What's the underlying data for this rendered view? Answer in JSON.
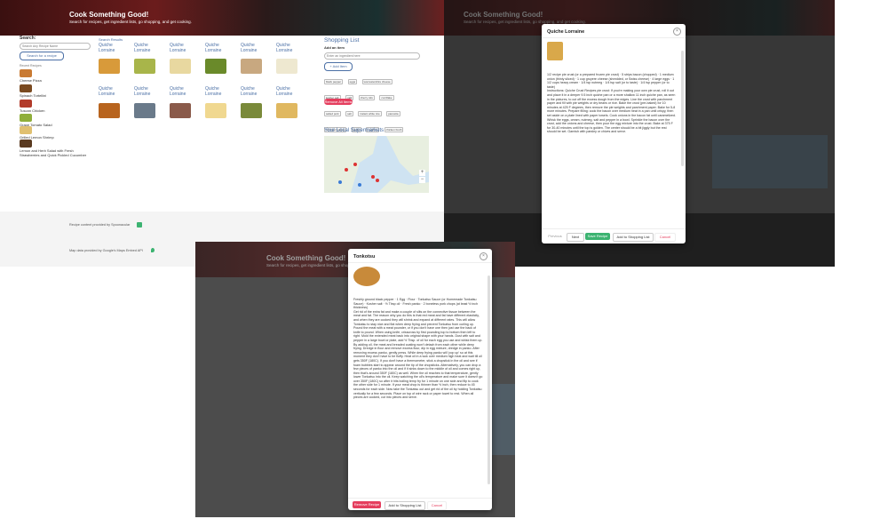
{
  "app": {
    "title": "Cook Something Good!",
    "subtitle": "Search for recipes, get ingredient lists, go shopping, and get cooking."
  },
  "search": {
    "label": "Search:",
    "placeholder": "Search Any Recipe Name",
    "button": "Search for a recipe",
    "results_label": "Search Results"
  },
  "history": {
    "label": "Recent Recipes",
    "items": [
      "Cheese Pizza",
      "Spinach Tortellini",
      "Tuscan Chicken",
      "Grape Tomato Salad",
      "Grilled Lemon Shrimp",
      "Garlic Potato Pancake",
      "Green Salad",
      "Lemon and Herb Salad with Fresh Strawberries and Quick Pickled Cucumber"
    ]
  },
  "results": {
    "row1": [
      "Quiche Lorraine",
      "Quiche Lorraine",
      "Quiche Lorraine",
      "Quiche Lorraine",
      "Quiche Lorraine",
      "Quiche Lorraine"
    ],
    "row2": [
      "Quiche Lorraine",
      "Quiche Lorraine",
      "Quiche Lorraine",
      "Quiche Lorraine",
      "Quiche Lorraine",
      "Quiche Lorraine"
    ]
  },
  "shopping": {
    "title": "Shopping List",
    "add_label": "Add an item",
    "input_placeholder": "Enter an ingredient here",
    "add_button": "+ Add Item",
    "chips": [
      "black pepper",
      "eggs",
      "worcestershire cheese",
      "kosher salt",
      "milk",
      "cherry tofu",
      "cornflake",
      "salted pork",
      "salt",
      "instant white rice",
      "pancetta",
      "rich beef patties",
      "garlic",
      "zucchini",
      "chicken broth",
      "flour",
      "cilantro",
      "fish sauce",
      "sharp cheddar",
      "onion"
    ],
    "remove_button": "Remove All Items"
  },
  "supermarkets": {
    "title": "Your Local Supermarkets"
  },
  "footer": {
    "recipe_credit": "Recipe content provided by Spoonacular",
    "map_credit": "Map data provided by Google's Maps Embed API"
  },
  "modal1": {
    "title": "Quiche Lorraine",
    "ingredients": "1/2 recipe pie crust (or a prepared frozen pie crust) · 5 strips bacon (chopped) · 1 medium onion (thinly sliced) · 1 cup gruyere cheese (shredded, or Swiss cheese) · 4 large eggs · 1 1/2 cups heavy cream · 1/4 tsp nutmeg · 1/4 tsp salt (or to taste) · 1/4 tsp pepper (or to taste)",
    "instructions": "Instructions: Quiche Crust Recipes pie crust: If you're making your own pie crust, roll it out and place it in a deeper 9.5 inch quiche pan or a more shallow 11 inch quiche pan, as seen in the pictures, to cut off the excess dough from the edges. Line the crust with parchment paper and fill with pie weights or dry beans or rice. Bake the crust (pre-baked) for 10 minutes at 425 F degrees, then remove the pie weights and parchment paper. Bake for 5-8 more minutes. Prepare filling: cook the bacon over medium heat in a pan until crispy, then set aside on a plate lined with paper towels. Cook onions in the bacon fat until caramelized. Whisk the eggs, cream, nutmeg, salt and pepper in a bowl. Sprinkle the bacon over the crust, add the onions and cheese, then pour the egg mixture into the crust. Bake at 375 F for 30-40 minutes until the top is golden. The center should be a bit jiggly but the rest should be set. Garnish with parsley or chives and serve.",
    "buttons": [
      "Previous",
      "Next",
      "Save Recipe",
      "Add to Shopping List",
      "Cancel"
    ]
  },
  "modal2": {
    "title": "Tonkotsu",
    "ingredients": "Freshly ground black pepper · 1 Egg · Flour · Tonkatsu Sauce (or Homemade Tonkatsu Sauce) · Kosher salt · ½ Tbsp oil · Fresh panko · 2 boneless pork chops (at least ½ inch thickness)",
    "instructions": "Get rid of the extra fat and make a couple of slits on the connective tissue between the meat and fat. The reason why you do this is that red meat and fat have different elasticity, and when they are cooked they will shrink and expand at different rates. This will allow Tonkatsu to stay nice and flat when deep frying and prevent Tonkatsu from curling up. Pound the meat with a meat pounder, or if you don't have one then just use the back of knife to pound. When using knife, crisscross by first pounding top to bottom then left to right. Mold the extended meat back into original shape with your hands. Dust with salt and pepper in a large bowl or plate, add ½ Tbsp. of oil for each egg you use and whisk them up. By adding oil, the meat and breaded coating won't detach from each other while deep frying. Dredge in flour and remove excess flour, dip in egg mixture, dredge in panko. After removing excess panko, gently press. While deep frying panko will 'pop up' so at this moment they don't have to be fluffy. Heat oil in a wok over medium high heat and wait till oil gets 350F (180C). If you don't have a thermometer, stick a chopstick in the oil and see if foam bubbles start to appear around the tip of the chopsticks. Alternatively, you can drop a few pieces of panko into the oil and if it sinks down to the middle of oil and comes right up, then that's around 350F (180C) as well. When the oil reaches to that temperature, gently lower Tonkatsu into the oil. Keep watching the oil's temperature and make sure it doesn't go over 350F (180C) so after it hits boiling temp fry for 1 minute on one side and flip to cook the other side for 1 minute. If your meat chop is thinner than ½ inch, then reduce to 45 seconds for each side. Now take the Tonkatsu out and get rid of the oil by holding Tonkatsu vertically for a few seconds. Place on top of wire rack or paper towel to rest. When all pieces are cooked, cut into pieces and serve.",
    "buttons": [
      "Remove Recipe",
      "Add to Shopping List",
      "Cancel"
    ]
  },
  "colors": {
    "accent_red": "#e53e5e",
    "accent_green": "#3cb371",
    "link_blue": "#4a6fa5"
  }
}
